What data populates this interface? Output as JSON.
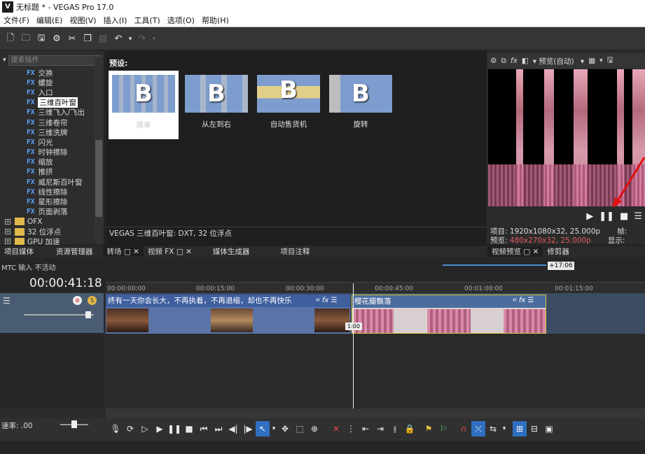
{
  "window": {
    "title": "无标题 * - VEGAS Pro 17.0",
    "logo": "V"
  },
  "menu": [
    "文件(F)",
    "编辑(E)",
    "视图(V)",
    "插入(I)",
    "工具(T)",
    "选项(O)",
    "帮助(H)"
  ],
  "fx_tree": {
    "search_placeholder": "搜索插件",
    "badge": "FX",
    "items": [
      "交换",
      "螺旋",
      "入口",
      "三维百叶窗",
      "三维飞入/飞出",
      "三维卷帘",
      "三维洗牌",
      "闪光",
      "时钟擦除",
      "缩放",
      "推挤",
      "威尼斯百叶窗",
      "线性擦除",
      "星形擦除",
      "页面剥落"
    ],
    "selected": "三维百叶窗",
    "folders": [
      "OFX",
      "32 位浮点",
      "GPU 加速"
    ]
  },
  "presets": {
    "label": "预设:",
    "items": [
      {
        "name": "简单",
        "glyph": "B"
      },
      {
        "name": "从左到右",
        "glyph": "B"
      },
      {
        "name": "自动售货机",
        "glyph": "B"
      },
      {
        "name": "旋转",
        "glyph": "B"
      }
    ],
    "status": "VEGAS 三维百叶窗: DXT, 32 位浮点"
  },
  "preview": {
    "toolbar_label": "预览(自动)",
    "project_label": "项目:",
    "project_value": "1920x1080x32, 25.000p",
    "preview_label": "预览:",
    "preview_value": "480x270x32, 25.000p",
    "frame_label": "帧:",
    "display_label": "显示:"
  },
  "dock_left": [
    "项目媒体",
    "资源管理器",
    "转场",
    "视频 FX",
    "媒体生成器",
    "项目注释"
  ],
  "dock_right": [
    "视频预览",
    "修剪器"
  ],
  "timeline": {
    "mtc": "MTC 输入 不活动",
    "timecode": "00:00:41:18",
    "ruler": [
      "00:00:00:00",
      "00:00:15:00",
      "00:00:30:00",
      "00:00:45:00",
      "00:01:00:00",
      "00:01:15:00"
    ],
    "nav_label": "+17:06",
    "cursor_label": "1:00",
    "clip1": "终有一天你会长大，不再执着，不再退缩，却也不再快乐",
    "clip2": "樱花瓣飘落",
    "rate": "速率: .00"
  },
  "colors": {
    "accent": "#2f6fc1",
    "clip_video": "#5a74a8",
    "highlight_red": "#e35b5b",
    "fx_badge": "#5aa6ff"
  }
}
